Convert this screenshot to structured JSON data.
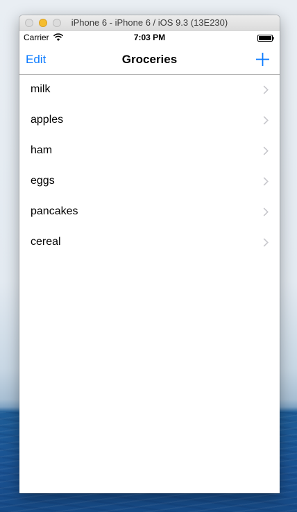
{
  "window": {
    "title": "iPhone 6 - iPhone 6 / iOS 9.3 (13E230)"
  },
  "status_bar": {
    "carrier": "Carrier",
    "time": "7:03 PM",
    "icons": [
      "wifi-icon",
      "battery-icon"
    ]
  },
  "nav_bar": {
    "left_label": "Edit",
    "title": "Groceries",
    "right_icon": "add-icon"
  },
  "list": {
    "items": [
      {
        "label": "milk"
      },
      {
        "label": "apples"
      },
      {
        "label": "ham"
      },
      {
        "label": "eggs"
      },
      {
        "label": "pancakes"
      },
      {
        "label": "cereal"
      }
    ],
    "row_accessory_icon": "chevron-right-icon"
  },
  "colors": {
    "tint": "#0a7aff",
    "chevron": "#c7c7cc",
    "separator": "#b2b2b2",
    "traffic_light_minimize": "#f5bd2f"
  }
}
